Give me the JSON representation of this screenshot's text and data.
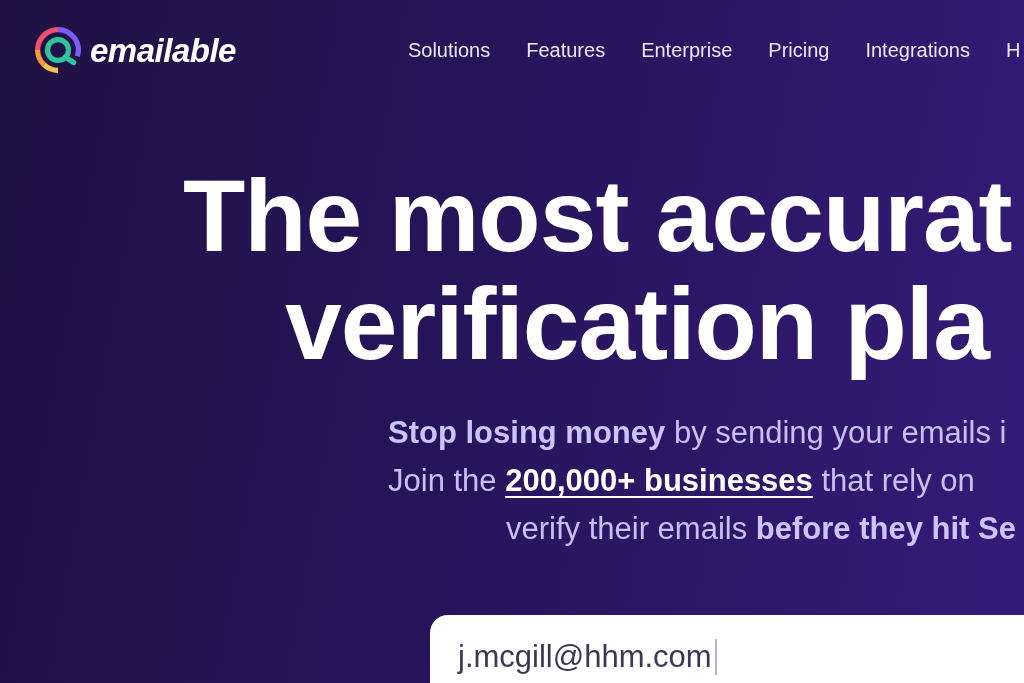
{
  "logo": {
    "text": "emailable"
  },
  "nav": {
    "items": [
      "Solutions",
      "Features",
      "Enterprise",
      "Pricing",
      "Integrations",
      "H"
    ]
  },
  "hero": {
    "headline": [
      "The most accurat",
      "verification pla"
    ],
    "subtitle": [
      [
        {
          "kind": "text",
          "text": "**Stop losing money** by sending your emails i"
        }
      ],
      [
        {
          "kind": "text",
          "text": "Join the "
        },
        {
          "kind": "link",
          "text": "200,000+ businesses"
        },
        {
          "kind": "text",
          "text": " that rely on"
        }
      ],
      [
        {
          "kind": "text",
          "text": "verify their emails **before they hit Se**"
        }
      ]
    ]
  },
  "email_field": {
    "value": "j.mcgill@hhm.com",
    "focused": true
  }
}
